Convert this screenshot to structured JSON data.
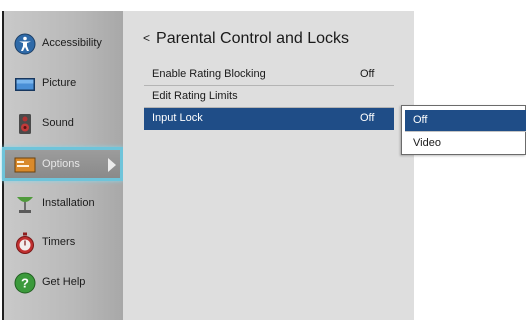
{
  "sidebar": {
    "items": [
      {
        "label": "Accessibility",
        "icon": "accessibility-icon"
      },
      {
        "label": "Picture",
        "icon": "picture-icon"
      },
      {
        "label": "Sound",
        "icon": "speaker-icon"
      },
      {
        "label": "Options",
        "icon": "options-icon",
        "selected": true
      },
      {
        "label": "Installation",
        "icon": "satellite-dish-icon"
      },
      {
        "label": "Timers",
        "icon": "stopwatch-icon"
      },
      {
        "label": "Get Help",
        "icon": "help-icon"
      }
    ]
  },
  "panel": {
    "back": "<",
    "title": "Parental Control and Locks",
    "rows": [
      {
        "label": "Enable Rating Blocking",
        "value": "Off"
      },
      {
        "label": "Edit Rating Limits",
        "value": ""
      },
      {
        "label": "Input Lock",
        "value": "Off",
        "selected": true
      }
    ]
  },
  "popup": {
    "options": [
      {
        "label": "Off",
        "selected": true
      },
      {
        "label": "Video"
      }
    ]
  },
  "colors": {
    "selection": "#1f4d87",
    "focus_border": "#6fc4da",
    "sidebar": "#c9c9c9",
    "panel": "#dedede"
  }
}
